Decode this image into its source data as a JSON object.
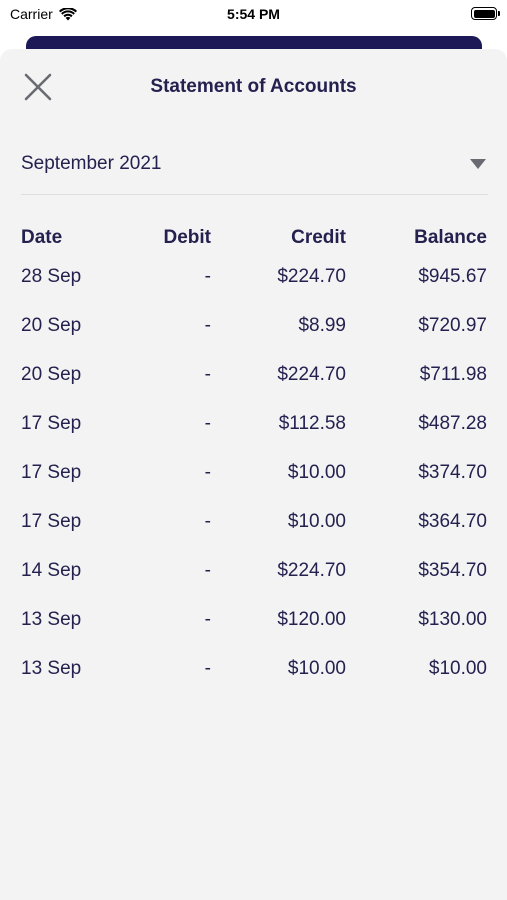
{
  "status_bar": {
    "carrier": "Carrier",
    "time": "5:54 PM"
  },
  "sheet": {
    "title": "Statement of Accounts",
    "close_icon": "close-x-icon"
  },
  "month_select": {
    "value": "September 2021",
    "icon": "caret-down-icon"
  },
  "table": {
    "headers": {
      "date": "Date",
      "debit": "Debit",
      "credit": "Credit",
      "balance": "Balance"
    },
    "rows": [
      {
        "date": "28 Sep",
        "debit": "-",
        "credit": "$224.70",
        "balance": "$945.67"
      },
      {
        "date": "20 Sep",
        "debit": "-",
        "credit": "$8.99",
        "balance": "$720.97"
      },
      {
        "date": "20 Sep",
        "debit": "-",
        "credit": "$224.70",
        "balance": "$711.98"
      },
      {
        "date": "17 Sep",
        "debit": "-",
        "credit": "$112.58",
        "balance": "$487.28"
      },
      {
        "date": "17 Sep",
        "debit": "-",
        "credit": "$10.00",
        "balance": "$374.70"
      },
      {
        "date": "17 Sep",
        "debit": "-",
        "credit": "$10.00",
        "balance": "$364.70"
      },
      {
        "date": "14 Sep",
        "debit": "-",
        "credit": "$224.70",
        "balance": "$354.70"
      },
      {
        "date": "13 Sep",
        "debit": "-",
        "credit": "$120.00",
        "balance": "$130.00"
      },
      {
        "date": "13 Sep",
        "debit": "-",
        "credit": "$10.00",
        "balance": "$10.00"
      }
    ]
  },
  "colors": {
    "text": "#25214f",
    "sheet_background": "#f3f3f4",
    "behind_sheet": "#1d1856",
    "divider": "#dedee3"
  }
}
